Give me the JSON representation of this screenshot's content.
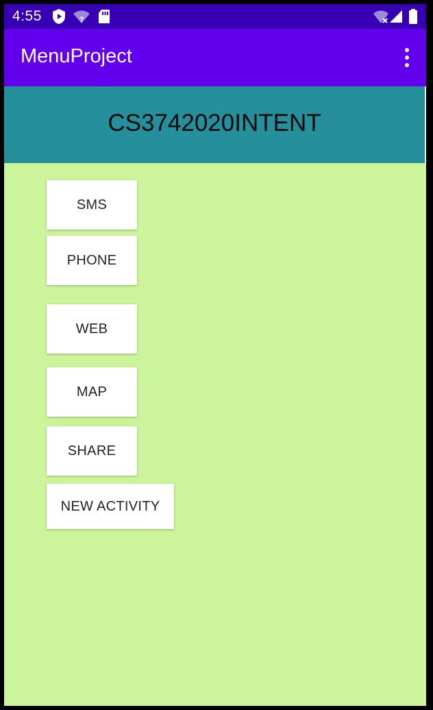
{
  "status_bar": {
    "time": "4:55",
    "left_icons": [
      "play-protect-icon",
      "wifi-unknown-icon",
      "sd-card-icon"
    ],
    "right_icons": [
      "wifi-no-internet-icon",
      "cell-signal-icon",
      "battery-icon"
    ],
    "background": "#3700B3"
  },
  "app_bar": {
    "title": "MenuProject",
    "overflow_icon": "more-vert-icon",
    "background": "#6200EE"
  },
  "header": {
    "text": "CS3742020INTENT",
    "background": "#258F9C"
  },
  "buttons": {
    "sms": "SMS",
    "phone": "PHONE",
    "web": "WEB",
    "map": "MAP",
    "share": "SHARE",
    "new_activity": "NEW ACTIVITY"
  },
  "content_background": "#CCF49A"
}
